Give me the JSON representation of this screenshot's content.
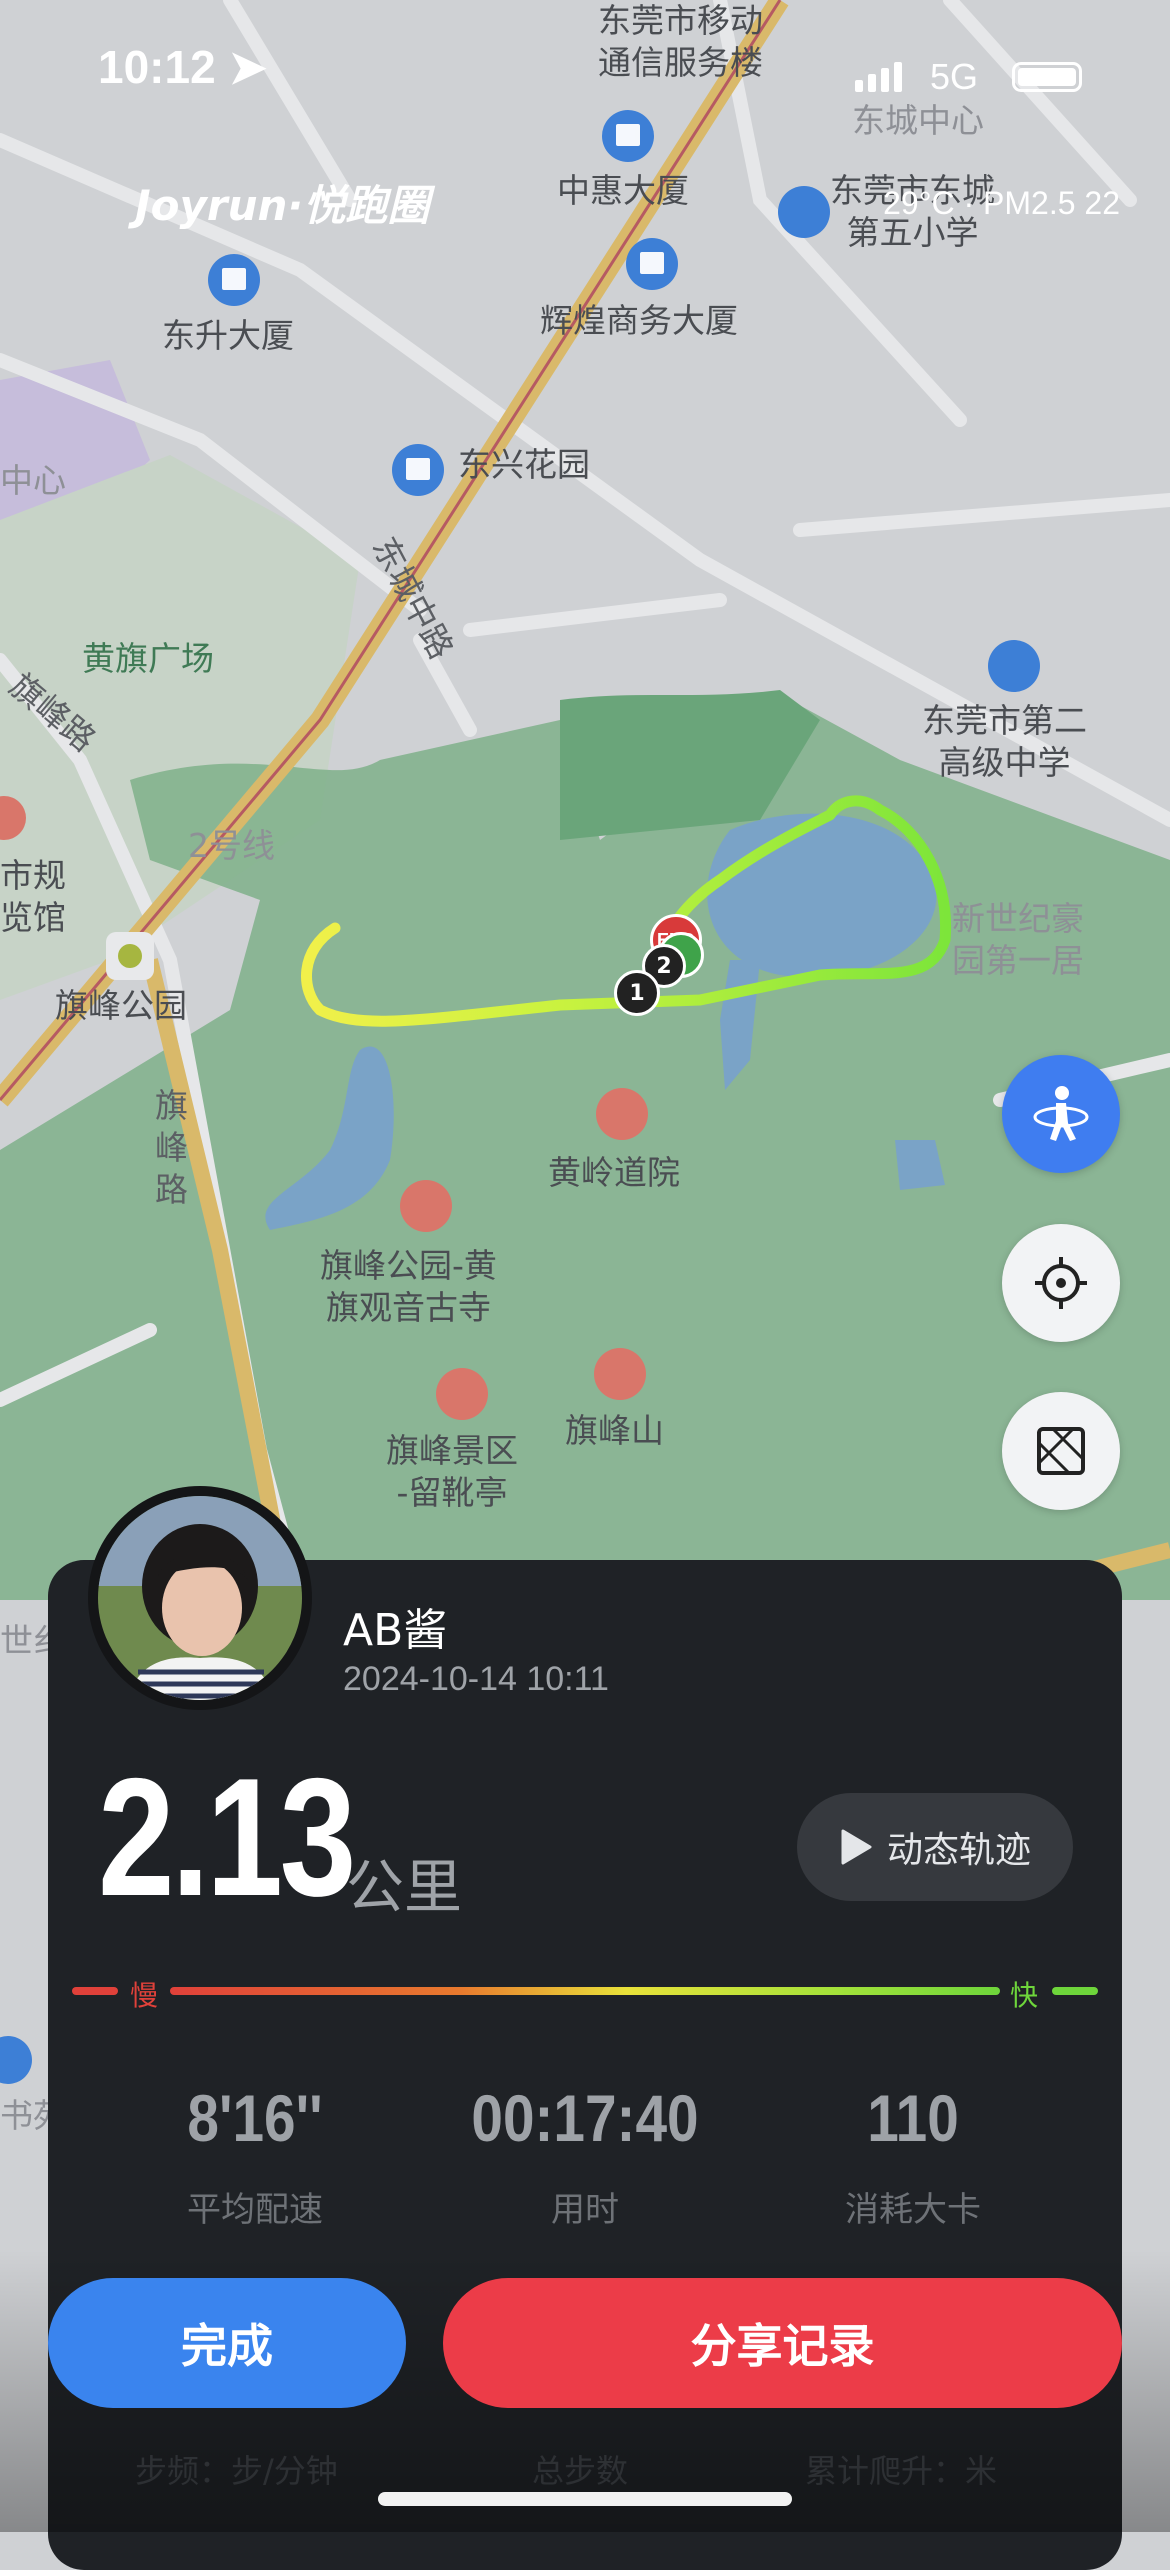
{
  "status_bar": {
    "time": "10:12",
    "network": "5G"
  },
  "brand": "Joyrun·悦跑圈",
  "weather": "29°C · PM2.5 22",
  "map": {
    "labels": [
      {
        "text": "东莞市移动\n通信服务楼",
        "style": "normal"
      },
      {
        "text": "东城中心",
        "style": "faded"
      },
      {
        "text": "中惠大厦",
        "style": "normal"
      },
      {
        "text": "东莞市东城\n第五小学",
        "style": "normal"
      },
      {
        "text": "东升大厦",
        "style": "normal"
      },
      {
        "text": "辉煌商务大厦",
        "style": "normal"
      },
      {
        "text": "东兴花园",
        "style": "normal"
      },
      {
        "text": "中心",
        "style": "faded"
      },
      {
        "text": "东城中路",
        "style": "road"
      },
      {
        "text": "黄旗广场",
        "style": "green"
      },
      {
        "text": "旗峰路",
        "style": "road"
      },
      {
        "text": "东莞市第二\n高级中学",
        "style": "normal"
      },
      {
        "text": "市规\n览馆",
        "style": "normal"
      },
      {
        "text": "2号线",
        "style": "faded"
      },
      {
        "text": "新世纪豪\n园第一居",
        "style": "faded"
      },
      {
        "text": "旗峰公园",
        "style": "normal"
      },
      {
        "text": "旗\n峰\n路",
        "style": "road"
      },
      {
        "text": "黄岭道院",
        "style": "normal"
      },
      {
        "text": "旗峰公园-黄\n旗观音古寺",
        "style": "normal"
      },
      {
        "text": "旗峰景区\n-留靴亭",
        "style": "normal"
      },
      {
        "text": "旗峰山",
        "style": "normal"
      },
      {
        "text": "世纟",
        "style": "faded"
      },
      {
        "text": "书苑",
        "style": "faded"
      }
    ],
    "markers": {
      "end": "END",
      "km1": "1",
      "km2": "2"
    }
  },
  "controls": [
    {
      "name": "run-mode-icon"
    },
    {
      "name": "locate-icon"
    },
    {
      "name": "map-layer-icon"
    }
  ],
  "user": {
    "name": "AB酱",
    "datetime": "2024-10-14 10:11"
  },
  "summary": {
    "distance": "2.13",
    "unit": "公里",
    "replay_label": "动态轨迹"
  },
  "pace_legend": {
    "slow": "慢",
    "fast": "快"
  },
  "stats": [
    {
      "value": "8'16''",
      "label": "平均配速"
    },
    {
      "value": "00:17:40",
      "label": "用时"
    },
    {
      "value": "110",
      "label": "消耗大卡"
    }
  ],
  "actions": {
    "done": "完成",
    "share": "分享记录"
  },
  "more_stats_labels": [
    "步频：步/分钟",
    "总步数",
    "累计爬升：米"
  ],
  "colors": {
    "primary_blue": "#3a84ee",
    "share_red": "#ec3c48",
    "pace_slow": "#e0413a",
    "pace_fast": "#6ed63b"
  }
}
